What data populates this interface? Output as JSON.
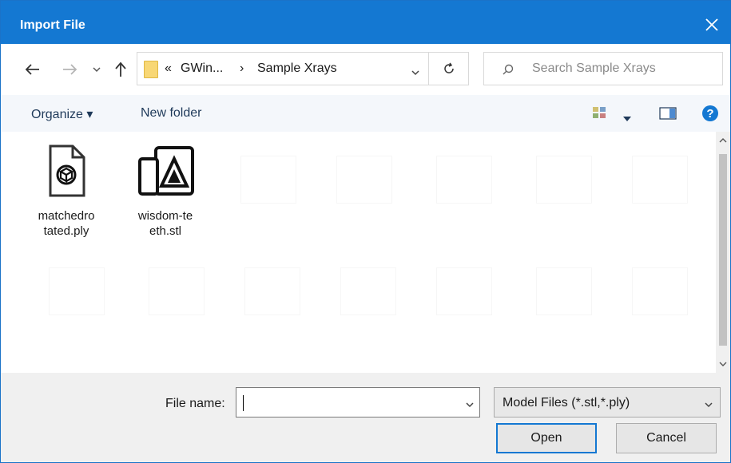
{
  "window": {
    "title": "Import File"
  },
  "address": {
    "prefix": "«",
    "parent": "GWin...",
    "separator": "›",
    "current": "Sample Xrays"
  },
  "search": {
    "placeholder": "Search Sample Xrays"
  },
  "toolbar": {
    "organize_label": "Organize ▾",
    "new_folder_label": "New folder"
  },
  "files": [
    {
      "label_line1": "matchedro",
      "label_line2": "tated.ply",
      "icon": "ply-file-icon"
    },
    {
      "label_line1": "wisdom-te",
      "label_line2": "eth.stl",
      "icon": "stl-file-icon"
    }
  ],
  "footer": {
    "filename_label": "File name:",
    "filename_value": "",
    "filter_value": "Model Files (*.stl,*.ply)",
    "open_label": "Open",
    "cancel_label": "Cancel"
  },
  "colors": {
    "accent": "#1478d2",
    "help": "#1478d2"
  }
}
